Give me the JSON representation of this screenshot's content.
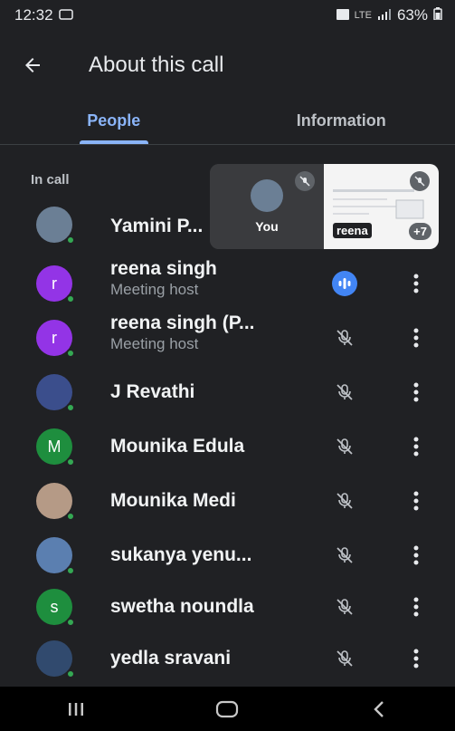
{
  "status": {
    "time": "12:32",
    "signal_text": "LTE",
    "battery": "63%"
  },
  "header": {
    "title": "About this call"
  },
  "tabs": [
    {
      "label": "People",
      "active": true
    },
    {
      "label": "Information",
      "active": false
    }
  ],
  "section_label": "In call",
  "preview": {
    "you_label": "You",
    "other_name": "reena",
    "extra_count": "+7"
  },
  "participants": [
    {
      "name": "Yamini P...",
      "sub": "",
      "avatar_letter": "",
      "avatar_color": "#6b7f95",
      "mic": "none"
    },
    {
      "name": "reena singh",
      "sub": "Meeting host",
      "avatar_letter": "r",
      "avatar_color": "#9334e6",
      "mic": "speaking"
    },
    {
      "name": "reena singh (P...",
      "sub": "Meeting host",
      "avatar_letter": "r",
      "avatar_color": "#9334e6",
      "mic": "muted"
    },
    {
      "name": "J Revathi",
      "sub": "",
      "avatar_letter": "",
      "avatar_color": "#3b4e8c",
      "mic": "muted"
    },
    {
      "name": "Mounika Edula",
      "sub": "",
      "avatar_letter": "M",
      "avatar_color": "#1e8e3e",
      "mic": "muted"
    },
    {
      "name": "Mounika Medi",
      "sub": "",
      "avatar_letter": "",
      "avatar_color": "#b59a86",
      "mic": "muted"
    },
    {
      "name": "sukanya yenu...",
      "sub": "",
      "avatar_letter": "",
      "avatar_color": "#5b7fb0",
      "mic": "muted"
    },
    {
      "name": "swetha noundla",
      "sub": "",
      "avatar_letter": "s",
      "avatar_color": "#1e8e3e",
      "mic": "muted"
    },
    {
      "name": "yedla sravani",
      "sub": "",
      "avatar_letter": "",
      "avatar_color": "#314a6e",
      "mic": "muted"
    }
  ],
  "colors": {
    "background": "#202124",
    "accent": "#8ab4f8",
    "speaking": "#4285f4",
    "online": "#34a853"
  }
}
